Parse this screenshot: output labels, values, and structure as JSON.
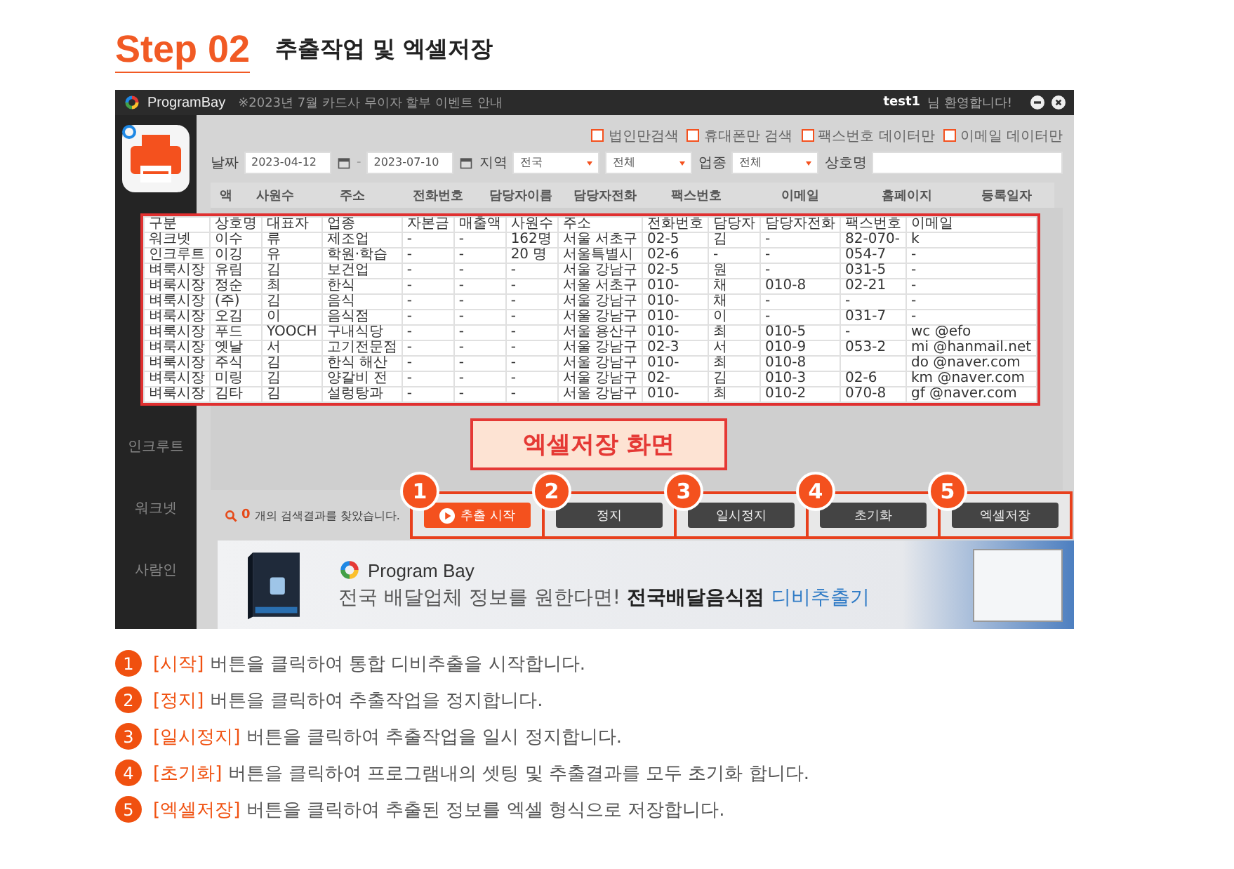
{
  "step": {
    "label": "Step 02",
    "title": "추출작업 및 엑셀저장"
  },
  "app": {
    "brand": "ProgramBay",
    "notice": "※2023년 7월 카드사 무이자 할부 이벤트 안내",
    "user": "test1",
    "welcome": "님 환영합니다!",
    "sidebar": {
      "items": [
        {
          "label": "인크루트"
        },
        {
          "label": "워크넷"
        },
        {
          "label": "사람인"
        }
      ]
    },
    "checkboxes": [
      {
        "label": "법인만검색",
        "checked": false
      },
      {
        "label": "휴대폰만 검색",
        "checked": false
      },
      {
        "label": "팩스번호 데이터만",
        "checked": false
      },
      {
        "label": "이메일 데이터만",
        "checked": false
      }
    ],
    "filters": {
      "date_label": "날짜",
      "date_from": "2023-04-12",
      "date_sep": "-",
      "date_to": "2023-07-10",
      "region_label": "지역",
      "region": "전국",
      "district": "전체",
      "industry_label": "업종",
      "industry": "전체",
      "name_label": "상호명"
    },
    "grid_columns": [
      "액",
      "사원수",
      "주소",
      "전화번호",
      "담당자이름",
      "담당자전화",
      "팩스번호",
      "이메일",
      "홈페이지",
      "등록일자"
    ],
    "export_table": {
      "columns": [
        "구분",
        "상호명",
        "대표자",
        "업종",
        "자본금",
        "매출액",
        "사원수",
        "주소",
        "전화번호",
        "담당자",
        "담당자전화",
        "팩스번호",
        "이메일"
      ],
      "rows": [
        [
          "워크넷",
          "이수",
          "류",
          "제조업",
          "-",
          "-",
          "162명",
          "서울 서초구",
          "02-5",
          "김",
          "-",
          "82-070-",
          "k"
        ],
        [
          "인크루트",
          "이깅",
          "유",
          "학원·학습",
          "-",
          "-",
          "20 명",
          "서울특별시",
          "02-6",
          "-",
          "-",
          "054-7",
          "-"
        ],
        [
          "벼룩시장",
          "유림",
          "김",
          "보건업",
          "-",
          "-",
          "-",
          "서울 강남구",
          "02-5",
          "원",
          "-",
          "031-5",
          "-"
        ],
        [
          "벼룩시장",
          "정순",
          "최",
          "한식",
          "-",
          "-",
          "-",
          "서울 서초구",
          "010-",
          "채",
          "010-8",
          "02-21",
          "-"
        ],
        [
          "벼룩시장",
          "(주)",
          "김",
          "음식",
          "-",
          "-",
          "-",
          "서울 강남구",
          "010-",
          "채",
          "-",
          "-",
          "-"
        ],
        [
          "벼룩시장",
          "오김",
          "이",
          "음식점",
          "-",
          "-",
          "-",
          "서울 강남구",
          "010-",
          "이",
          "-",
          "031-7",
          "-"
        ],
        [
          "벼룩시장",
          "푸드",
          "YOOCH",
          "구내식당",
          "-",
          "-",
          "-",
          "서울 용산구",
          "010-",
          "최",
          "010-5",
          "-",
          "wc @efo"
        ],
        [
          "벼룩시장",
          "옛날",
          "서",
          "고기전문점",
          "-",
          "-",
          "-",
          "서울 강남구",
          "02-3",
          "서",
          "010-9",
          "053-2",
          "mi @hanmail.net"
        ],
        [
          "벼룩시장",
          "주식",
          "김",
          "한식 해산",
          "-",
          "-",
          "-",
          "서울 강남구",
          "010-",
          "최",
          "010-8",
          "",
          "do @naver.com"
        ],
        [
          "벼룩시장",
          "미링",
          "김",
          "양갈비 전",
          "-",
          "-",
          "-",
          "서울 강남구",
          "02-",
          "김",
          "010-3",
          "02-6",
          "km @naver.com"
        ],
        [
          "벼룩시장",
          "김타",
          "김",
          "설렁탕과",
          "-",
          "-",
          "-",
          "서울 강남구",
          "010-",
          "최",
          "010-2",
          "070-8",
          "gf @naver.com"
        ]
      ]
    },
    "callout": "엑셀저장 화면",
    "status": {
      "count": "0",
      "text": "개의 검색결과를 찾았습니다."
    },
    "buttons": [
      {
        "badge": "1",
        "label": "추출 시작",
        "kind": "start"
      },
      {
        "badge": "2",
        "label": "정지",
        "kind": "normal"
      },
      {
        "badge": "3",
        "label": "일시정지",
        "kind": "normal"
      },
      {
        "badge": "4",
        "label": "초기화",
        "kind": "normal"
      },
      {
        "badge": "5",
        "label": "엑셀저장",
        "kind": "normal"
      }
    ],
    "banner": {
      "brand": "Program Bay",
      "headline": "전국 배달업체 정보를 원한다면! **전국배달음식점**",
      "highlight": "디비추출기"
    }
  },
  "instructions": [
    {
      "number": "1",
      "keyword": "[시작]",
      "text": "버튼을 클릭하여 통합 디비추출을 시작합니다."
    },
    {
      "number": "2",
      "keyword": "[정지]",
      "text": "버튼을 클릭하여 추출작업을 정지합니다."
    },
    {
      "number": "3",
      "keyword": "[일시정지]",
      "text": "버튼을 클릭하여 추출작업을 일시 정지합니다."
    },
    {
      "number": "4",
      "keyword": "[초기화]",
      "text": "버튼을 클릭하여 프로그램내의 셋팅 및 추출결과를 모두 초기화 합니다."
    },
    {
      "number": "5",
      "keyword": "[엑셀저장]",
      "text": "버튼을 클릭하여 추출된 정보를 엑셀 형식으로 저장합니다."
    }
  ]
}
